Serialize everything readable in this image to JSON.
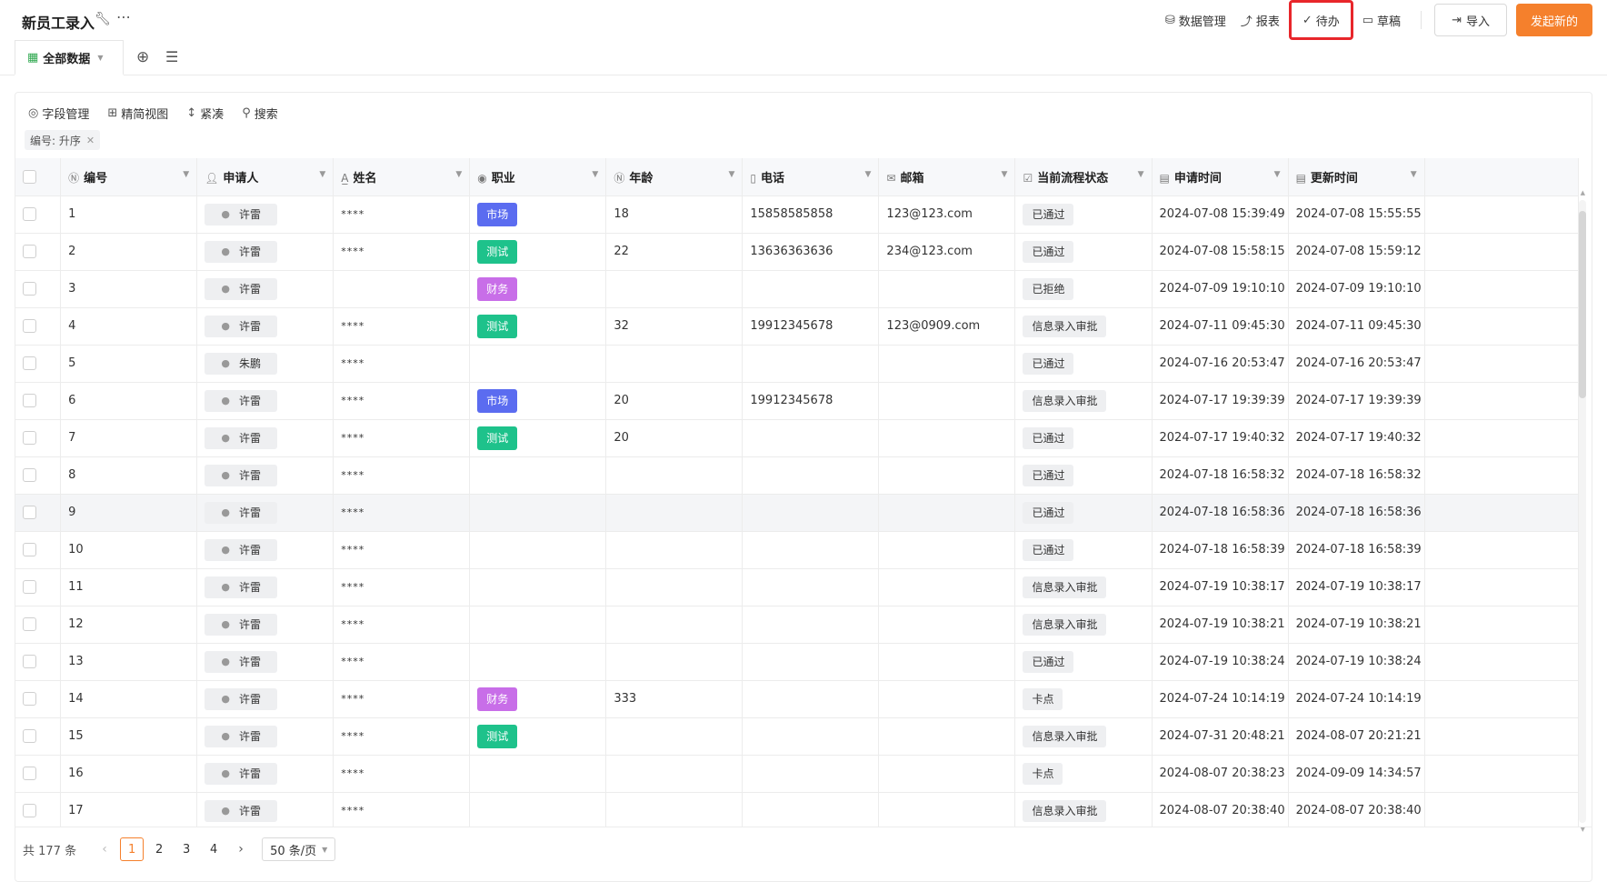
{
  "header": {
    "title": "新员工录入",
    "actions": {
      "data_manage": "数据管理",
      "report": "报表",
      "todo": "待办",
      "draft": "草稿",
      "import": "导入",
      "new": "发起新的"
    },
    "highlight_color": "#e8262b",
    "primary_color": "#f5802c"
  },
  "view_tab": {
    "label": "全部数据"
  },
  "toolbar": {
    "fields": "字段管理",
    "simple_view": "精简视图",
    "compact": "紧凑",
    "search": "搜索"
  },
  "sort_tag": "编号: 升序",
  "columns": {
    "id": "编号",
    "applicant": "申请人",
    "name": "姓名",
    "job": "职业",
    "age": "年龄",
    "phone": "电话",
    "email": "邮箱",
    "status": "当前流程状态",
    "applied": "申请时间",
    "updated": "更新时间"
  },
  "job_colors": {
    "市场": "#5b6cf0",
    "测试": "#1ec28b",
    "财务": "#c86ee8"
  },
  "rows": [
    {
      "id": "1",
      "applicant": "许雷",
      "name": "****",
      "job": "市场",
      "age": "18",
      "phone": "15858585858",
      "email": "123@123.com",
      "status": "已通过",
      "applied": "2024-07-08 15:39:49",
      "updated": "2024-07-08 15:55:55"
    },
    {
      "id": "2",
      "applicant": "许雷",
      "name": "****",
      "job": "测试",
      "age": "22",
      "phone": "13636363636",
      "email": "234@123.com",
      "status": "已通过",
      "applied": "2024-07-08 15:58:15",
      "updated": "2024-07-08 15:59:12"
    },
    {
      "id": "3",
      "applicant": "许雷",
      "name": "",
      "job": "财务",
      "age": "",
      "phone": "",
      "email": "",
      "status": "已拒绝",
      "applied": "2024-07-09 19:10:10",
      "updated": "2024-07-09 19:10:10"
    },
    {
      "id": "4",
      "applicant": "许雷",
      "name": "****",
      "job": "测试",
      "age": "32",
      "phone": "19912345678",
      "email": "123@0909.com",
      "status": "信息录入审批",
      "applied": "2024-07-11 09:45:30",
      "updated": "2024-07-11 09:45:30"
    },
    {
      "id": "5",
      "applicant": "朱鹏",
      "name": "****",
      "job": "",
      "age": "",
      "phone": "",
      "email": "",
      "status": "已通过",
      "applied": "2024-07-16 20:53:47",
      "updated": "2024-07-16 20:53:47"
    },
    {
      "id": "6",
      "applicant": "许雷",
      "name": "****",
      "job": "市场",
      "age": "20",
      "phone": "19912345678",
      "email": "",
      "status": "信息录入审批",
      "applied": "2024-07-17 19:39:39",
      "updated": "2024-07-17 19:39:39"
    },
    {
      "id": "7",
      "applicant": "许雷",
      "name": "****",
      "job": "测试",
      "age": "20",
      "phone": "",
      "email": "",
      "status": "已通过",
      "applied": "2024-07-17 19:40:32",
      "updated": "2024-07-17 19:40:32"
    },
    {
      "id": "8",
      "applicant": "许雷",
      "name": "****",
      "job": "",
      "age": "",
      "phone": "",
      "email": "",
      "status": "已通过",
      "applied": "2024-07-18 16:58:32",
      "updated": "2024-07-18 16:58:32"
    },
    {
      "id": "9",
      "applicant": "许雷",
      "name": "****",
      "job": "",
      "age": "",
      "phone": "",
      "email": "",
      "status": "已通过",
      "applied": "2024-07-18 16:58:36",
      "updated": "2024-07-18 16:58:36"
    },
    {
      "id": "10",
      "applicant": "许雷",
      "name": "****",
      "job": "",
      "age": "",
      "phone": "",
      "email": "",
      "status": "已通过",
      "applied": "2024-07-18 16:58:39",
      "updated": "2024-07-18 16:58:39"
    },
    {
      "id": "11",
      "applicant": "许雷",
      "name": "****",
      "job": "",
      "age": "",
      "phone": "",
      "email": "",
      "status": "信息录入审批",
      "applied": "2024-07-19 10:38:17",
      "updated": "2024-07-19 10:38:17"
    },
    {
      "id": "12",
      "applicant": "许雷",
      "name": "****",
      "job": "",
      "age": "",
      "phone": "",
      "email": "",
      "status": "信息录入审批",
      "applied": "2024-07-19 10:38:21",
      "updated": "2024-07-19 10:38:21"
    },
    {
      "id": "13",
      "applicant": "许雷",
      "name": "****",
      "job": "",
      "age": "",
      "phone": "",
      "email": "",
      "status": "已通过",
      "applied": "2024-07-19 10:38:24",
      "updated": "2024-07-19 10:38:24"
    },
    {
      "id": "14",
      "applicant": "许雷",
      "name": "****",
      "job": "财务",
      "age": "333",
      "phone": "",
      "email": "",
      "status": "卡点",
      "applied": "2024-07-24 10:14:19",
      "updated": "2024-07-24 10:14:19"
    },
    {
      "id": "15",
      "applicant": "许雷",
      "name": "****",
      "job": "测试",
      "age": "",
      "phone": "",
      "email": "",
      "status": "信息录入审批",
      "applied": "2024-07-31 20:48:21",
      "updated": "2024-08-07 20:21:21"
    },
    {
      "id": "16",
      "applicant": "许雷",
      "name": "****",
      "job": "",
      "age": "",
      "phone": "",
      "email": "",
      "status": "卡点",
      "applied": "2024-08-07 20:38:23",
      "updated": "2024-09-09 14:34:57"
    },
    {
      "id": "17",
      "applicant": "许雷",
      "name": "****",
      "job": "",
      "age": "",
      "phone": "",
      "email": "",
      "status": "信息录入审批",
      "applied": "2024-08-07 20:38:40",
      "updated": "2024-08-07 20:38:40"
    }
  ],
  "pagination": {
    "total": "共 177 条",
    "pages": [
      "1",
      "2",
      "3",
      "4"
    ],
    "current": "1",
    "per_page": "50 条/页"
  }
}
